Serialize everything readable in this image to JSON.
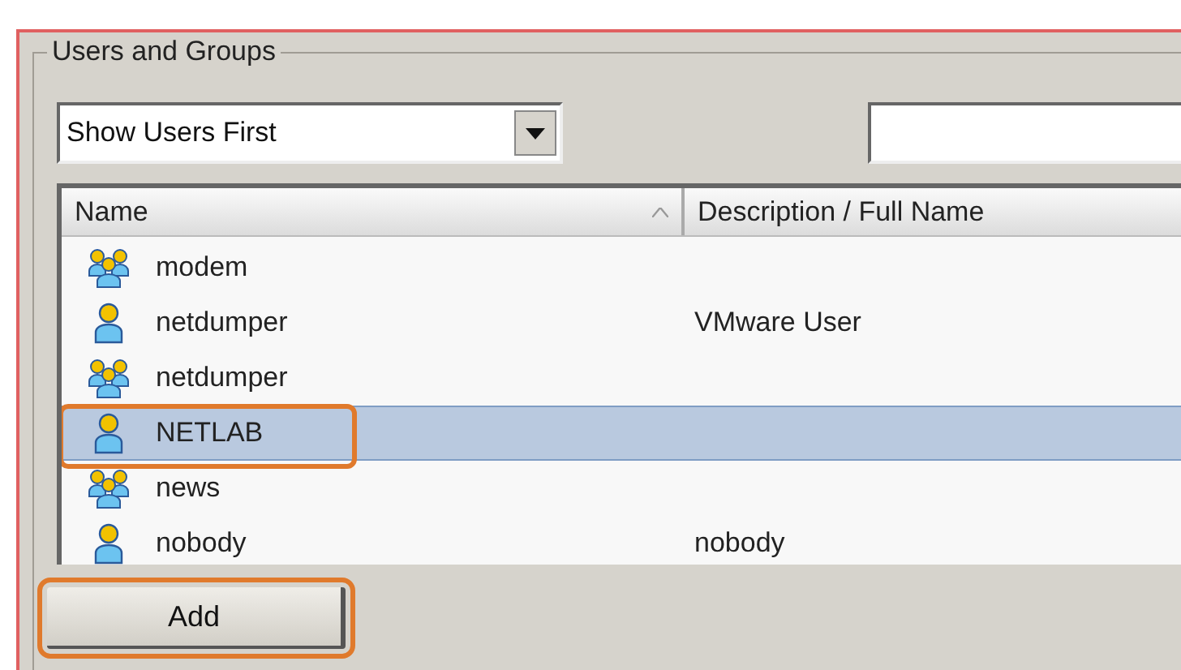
{
  "group_box": {
    "title": "Users and Groups"
  },
  "filter": {
    "value": "Show Users First"
  },
  "list": {
    "columns": [
      {
        "label": "Name",
        "sorted": true
      },
      {
        "label": "Description / Full Name",
        "sorted": false
      }
    ],
    "rows": [
      {
        "kind": "group",
        "name": "modem",
        "selected": false,
        "highlighted": false
      },
      {
        "kind": "user",
        "name": "netdumper",
        "description": "VMware User",
        "selected": false,
        "highlighted": false
      },
      {
        "kind": "group",
        "name": "netdumper",
        "selected": false,
        "highlighted": false
      },
      {
        "kind": "user",
        "name": "NETLAB",
        "selected": true,
        "highlighted": true
      },
      {
        "kind": "group",
        "name": "news",
        "selected": false,
        "highlighted": false
      },
      {
        "kind": "user",
        "name": "nobody",
        "description": "nobody",
        "selected": false,
        "highlighted": false
      }
    ]
  },
  "add_button": {
    "label": "Add",
    "highlighted": true
  }
}
